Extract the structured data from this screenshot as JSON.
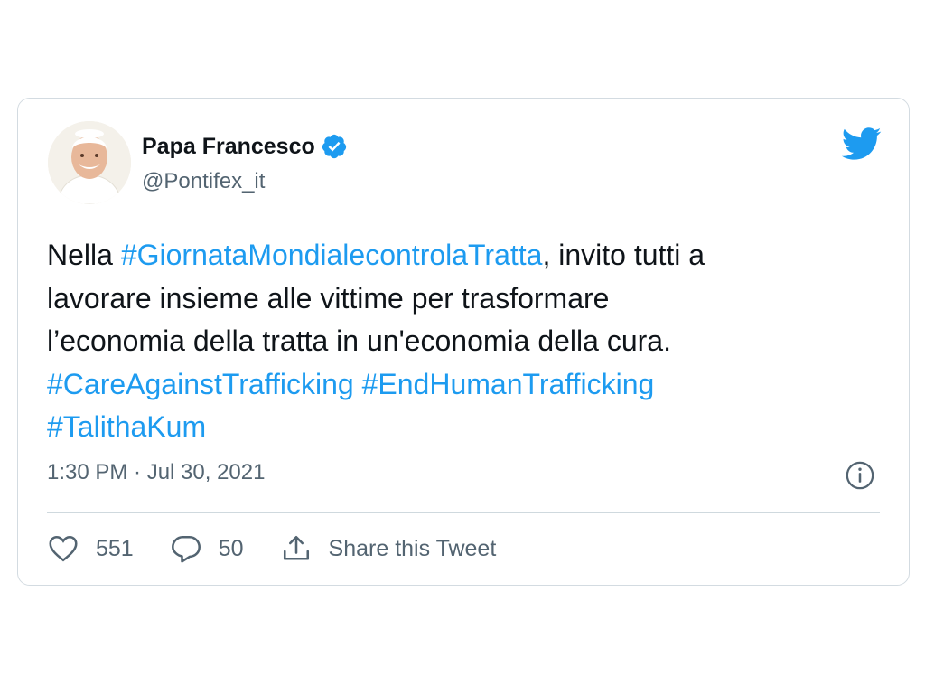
{
  "tweet": {
    "author": {
      "name": "Papa Francesco",
      "handle": "@Pontifex_it",
      "verified": true,
      "avatar_icon": "avatar-portrait"
    },
    "text": {
      "line1_pre": "Nella ",
      "line1_tag": "#GiornataMondialecontrolaTratta",
      "line1_post": ", invito tutti a",
      "line2": "lavorare insieme alle vittime per trasformare",
      "line3": "l’economia della tratta in un'economia della cura.",
      "tag_care": "#CareAgainstTrafficking",
      "tag_end": "#EndHumanTrafficking",
      "tag_talitha": "#TalithaKum"
    },
    "timestamp": "1:30 PM · Jul 30, 2021",
    "actions": {
      "likes": "551",
      "replies": "50",
      "share_label": "Share this Tweet"
    }
  },
  "icons": {
    "brand": "twitter-bird-icon",
    "info": "info-icon",
    "like": "heart-icon",
    "reply": "reply-icon",
    "share": "share-icon",
    "verified": "verified-badge-icon"
  },
  "colors": {
    "accent": "#1d9bf0",
    "text": "#0f1419",
    "secondary": "#536471",
    "border": "#cfd9de"
  }
}
